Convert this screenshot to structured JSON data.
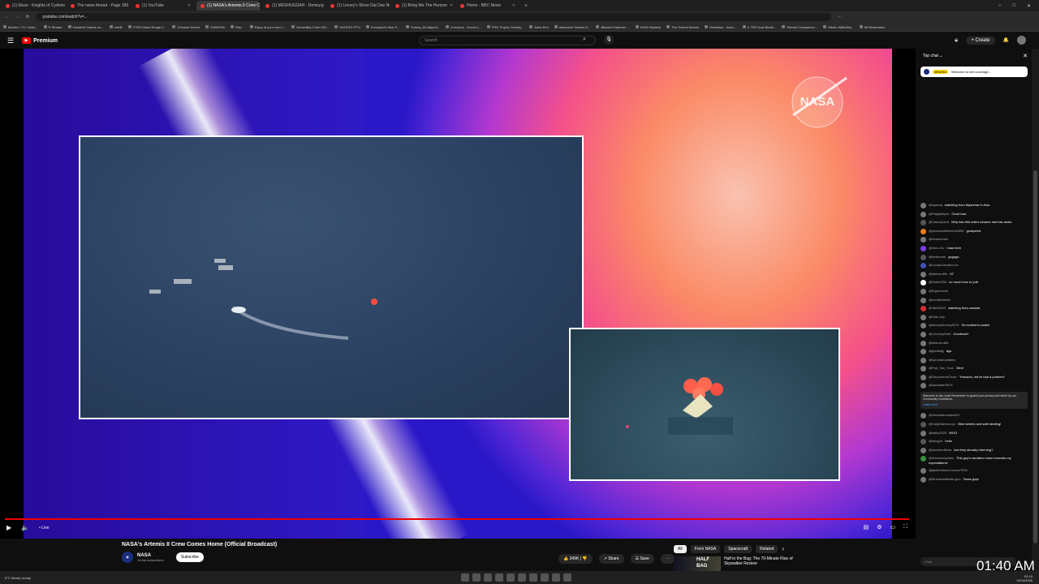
{
  "tabs": [
    {
      "title": "(1) Muse - Knights of Cydonia",
      "active": false
    },
    {
      "title": "The news thread - Page 189",
      "active": false
    },
    {
      "title": "(1) YouTube",
      "active": false
    },
    {
      "title": "(1) NASA's Artemis II Crew Co",
      "active": true
    },
    {
      "title": "(1) MESHUGGAH - Demiurg",
      "active": false
    },
    {
      "title": "(1) Linney's Show Dat Dee Nu",
      "active": false
    },
    {
      "title": "(1) Bring Me The Horizon",
      "active": false
    },
    {
      "title": "Home - BBC News",
      "active": false
    }
  ],
  "address": {
    "url": "youtube.com/watch?v=..."
  },
  "bookmarks": [
    "Movies / TV / Anim...",
    "R Stream",
    "Hastie42 boards on...",
    "reddit",
    "ITSSV Band Songs C...",
    "Crimson Desert",
    "GAMORA",
    "Rep...",
    "Enjoy at your own L...",
    "Generality Cube 440...",
    "HATESO IPTV",
    "theorylan's Nick S...",
    "Tommy_84 slipped...",
    "Liverpool - Soccer j...",
    "PSN Trophy Overlay...",
    "Artec Emi",
    "Awesome Games D...",
    "Blessed Hammer ...",
    "KDB2 Mystery",
    "The Owned Motors",
    "Heartless - Iceco...",
    "X TER Dual Blade...",
    "Stream Companion...",
    "Steam Wikkelby...",
    "All Bookmarks"
  ],
  "header": {
    "brand": "Premium",
    "search_placeholder": "Search",
    "create_label": "Create"
  },
  "player": {
    "live_label": "Live",
    "watermark": "NASA"
  },
  "video": {
    "title": "NASA's Artemis II Crew Comes Home (Official Broadcast)",
    "channel": "NASA",
    "subscribers": "14.6m subscribers",
    "subscribe_label": "Subscribe",
    "likes": "349K",
    "share_label": "Share",
    "save_label": "Save"
  },
  "recommendations": {
    "chips": [
      "All",
      "From NASA",
      "Spacecraft",
      "Related"
    ],
    "thumb_text": "HALF BAG",
    "item_title": "Half in the Bag: The 70-Minute Rise of Skywalker Review"
  },
  "chat": {
    "mode": "Top chat",
    "pinned_user": "@NASA",
    "pinned_text": "Welcome to live coverage...",
    "messages": [
      {
        "user": "@ispanaj",
        "text": "watching from Myanmar in Asia",
        "color": "#777"
      },
      {
        "user": "@Paiplpfisyes",
        "text": "Good luck",
        "color": "#777"
      },
      {
        "user": "@Catsoly/sed",
        "text": "Why has this entire mission had low audio",
        "color": "#555"
      },
      {
        "user": "@jonasmollbinbeck4580",
        "text": "godspeed",
        "color": "#e87b17"
      },
      {
        "user": "@mwaschar1",
        "text": "",
        "color": "#777"
      },
      {
        "user": "@Abn-c1k",
        "text": "I was here",
        "color": "#7b3fe4"
      },
      {
        "user": "@tmNervek",
        "text": "gogogo",
        "color": "#555"
      },
      {
        "user": "@LucasCarvalho-rto",
        "text": "",
        "color": "#3f51b5"
      },
      {
        "user": "@fatima.elfin",
        "text": "67",
        "color": "#777"
      },
      {
        "user": "@SetsiV934",
        "text": "so much love to y'all",
        "color": "#ffffff"
      },
      {
        "user": "@Bryanhovfn",
        "text": "",
        "color": "#777"
      },
      {
        "user": "@hoofiewiredd",
        "text": "",
        "color": "#777"
      },
      {
        "user": "@Talvi3333",
        "text": "watching from canada",
        "color": "#d32f2f"
      },
      {
        "user": "@Olds-bzy",
        "text": "",
        "color": "#777"
      },
      {
        "user": "@sherrydemory8274",
        "text": "So excited to watch",
        "color": "#777"
      },
      {
        "user": "@CrunchyGold",
        "text": "Goodluck!!",
        "color": "#777"
      },
      {
        "user": "@ktsenin-alfa",
        "text": "",
        "color": "#777"
      },
      {
        "user": "@gnhtkiilg",
        "text": "ags",
        "color": "#777"
      },
      {
        "user": "@kyrobarloadsbey",
        "text": "",
        "color": "#777"
      },
      {
        "user": "@Poe_Tae_Yoo1",
        "text": "39m!",
        "color": "#777"
      },
      {
        "user": "@DiscoveredCIrcle",
        "text": "\"Houston, we've had a problem\"",
        "color": "#777"
      },
      {
        "user": "@kaubader6974",
        "text": "",
        "color": "#777"
      }
    ],
    "notice_text": "Welcome to live chat! Remember to guard your privacy and abide by our Community Guidelines.",
    "notice_link": "Learn more",
    "messages2": [
      {
        "user": "@vitorladerosario822",
        "text": "",
        "color": "#777"
      },
      {
        "user": "@KaljuGames-xyz",
        "text": "Best wishes and safe landing!",
        "color": "#555"
      },
      {
        "user": "@kalby3329",
        "text": "WOO",
        "color": "#777"
      },
      {
        "user": "@ddog1h",
        "text": "hello",
        "color": "#555"
      },
      {
        "user": "@darbeirolticha",
        "text": "Are they already returning?",
        "color": "#777"
      },
      {
        "user": "@drewmcmplaex",
        "text": "This guy's narration voice exceeds my expectations!",
        "color": "#388e3c"
      },
      {
        "user": "@jacklordonez-house7516",
        "text": "",
        "color": "#777"
      },
      {
        "user": "@Muhamadbhain-gcu",
        "text": "Tama guys",
        "color": "#777"
      }
    ],
    "input_placeholder": "Chat..."
  },
  "taskbar": {
    "weather": "8°C Mostly cloudy",
    "time": "02:10",
    "date": "11/04/2026"
  },
  "overlay_time": "01:40 AM"
}
